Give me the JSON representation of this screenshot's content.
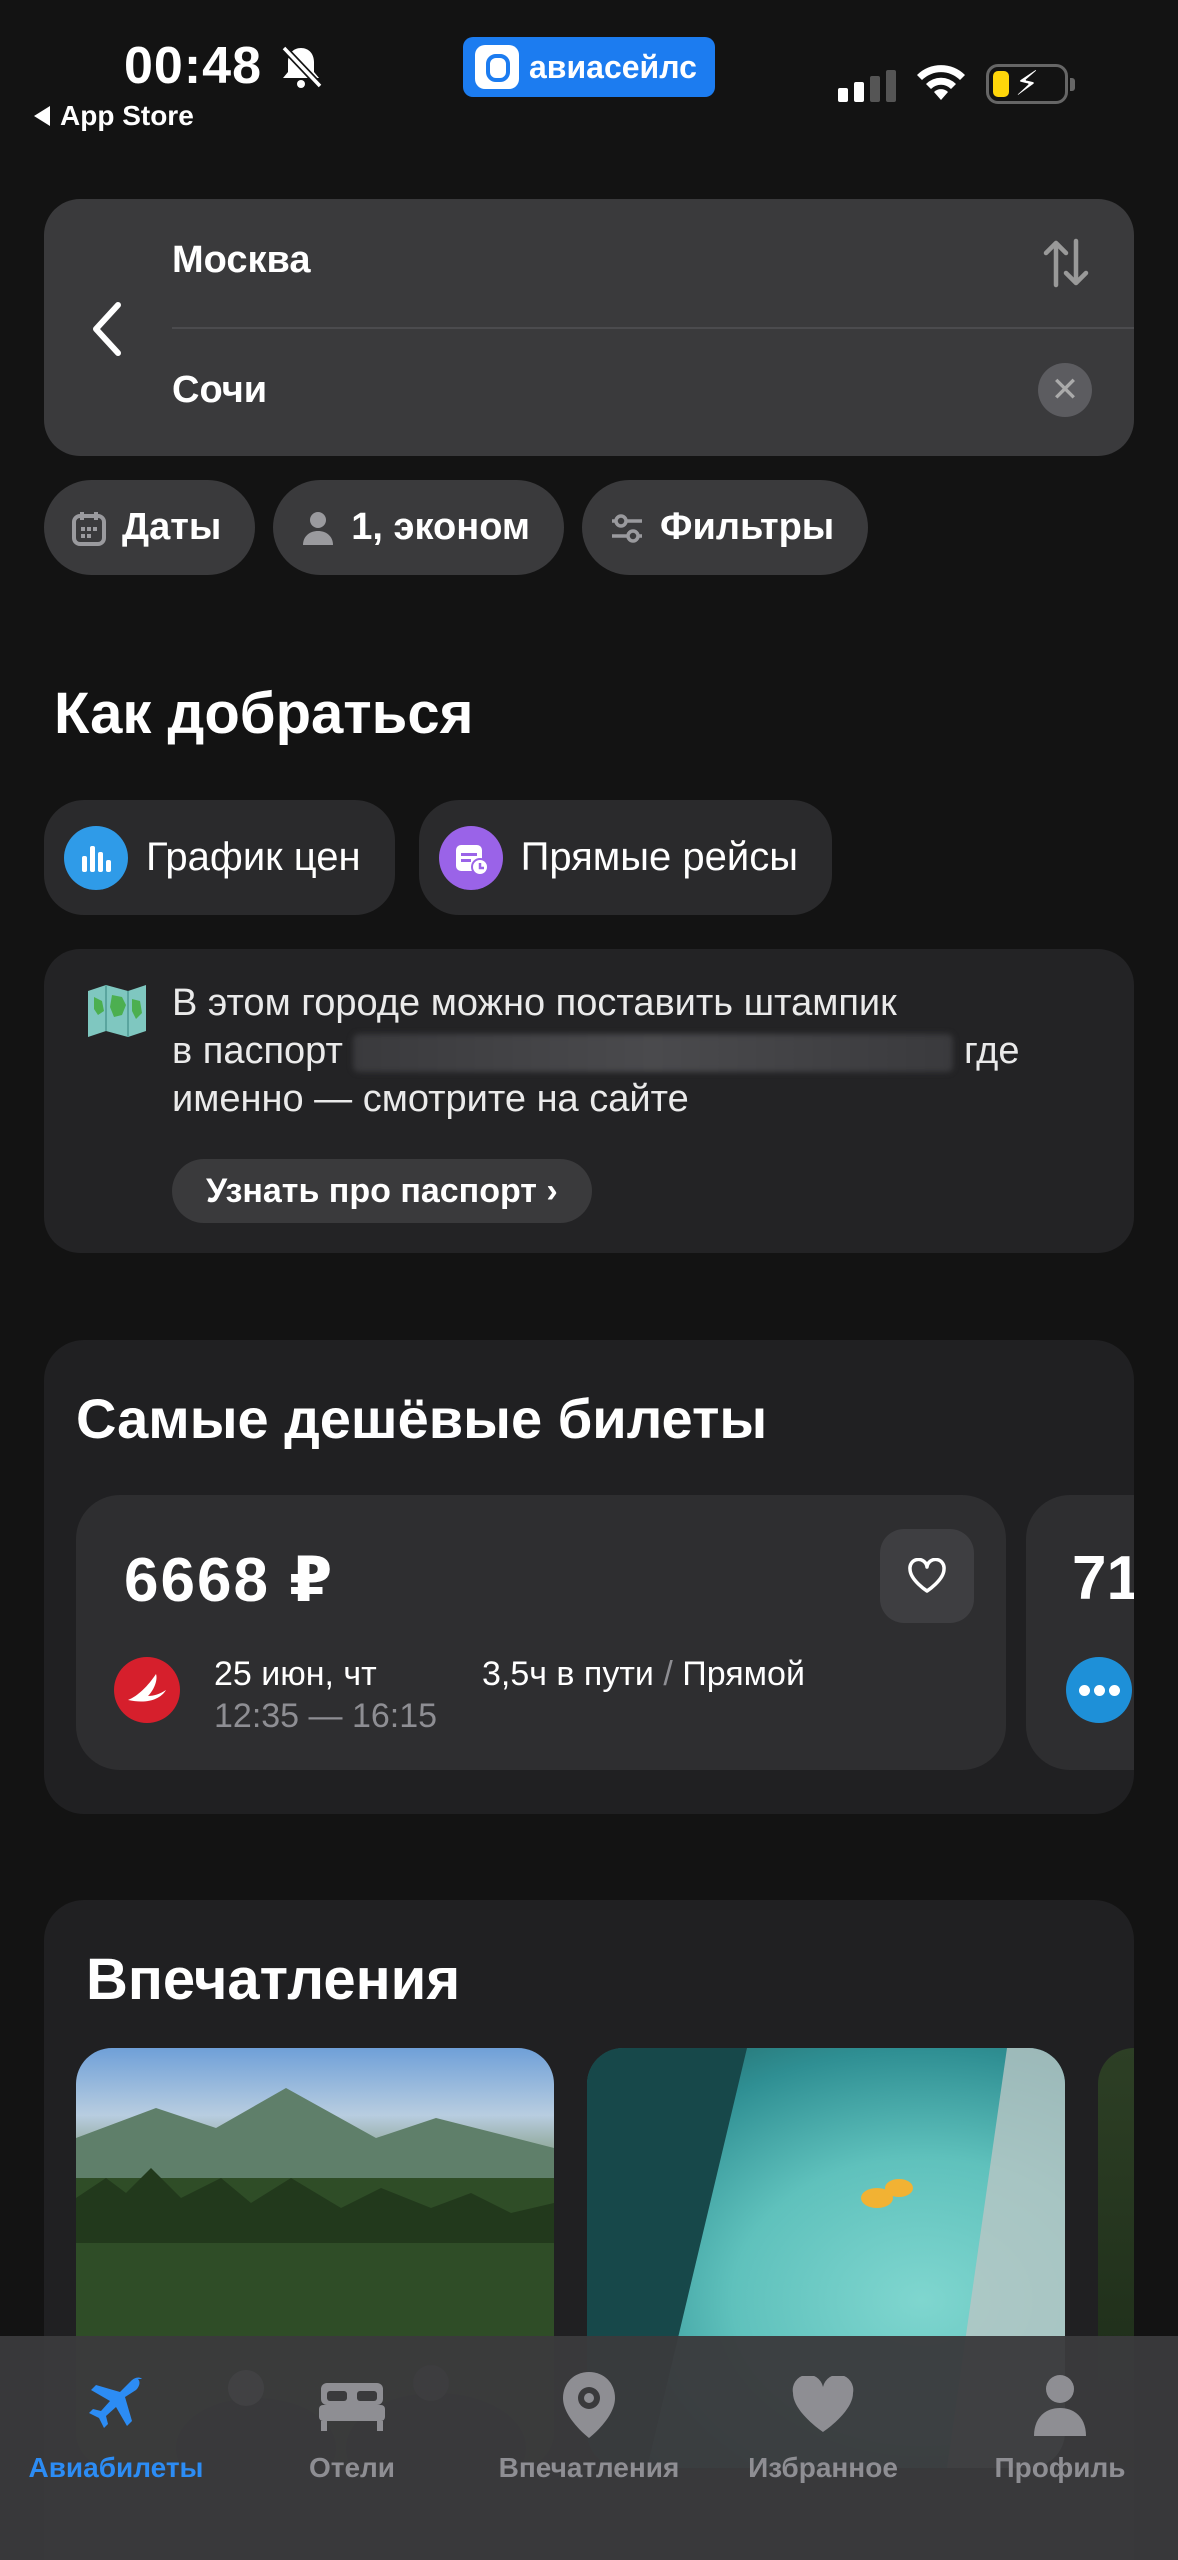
{
  "status_bar": {
    "time": "00:48",
    "back_label": "App Store",
    "brand": "авиасейлс"
  },
  "search": {
    "from": "Москва",
    "to": "Сочи"
  },
  "chips": [
    {
      "label": "Даты",
      "icon": "calendar-icon"
    },
    {
      "label": "1, эконом",
      "icon": "person-icon"
    },
    {
      "label": "Фильтры",
      "icon": "sliders-icon"
    }
  ],
  "how_to_get": {
    "title": "Как добраться",
    "price_chart_label": "График цен",
    "direct_flights_label": "Прямые рейсы"
  },
  "info_card": {
    "line1": "В этом городе можно поставить штампик",
    "line2_start": "в паспорт",
    "line2_end": "где",
    "line3": "именно — смотрите на сайте",
    "button": "Узнать про паспорт ›"
  },
  "cheapest": {
    "title": "Самые дешёвые билеты",
    "ticket": {
      "price": "6668 ₽",
      "date": "25 июн, чт",
      "times": "12:35 — 16:15",
      "duration": "3,5ч в пути",
      "separator": "/",
      "type": "Прямой"
    },
    "ticket2_price": "71"
  },
  "experiences": {
    "title": "Впечатления"
  },
  "tabbar": [
    {
      "label": "Авиабилеты",
      "icon": "airplane-icon",
      "active": true
    },
    {
      "label": "Отели",
      "icon": "bed-icon"
    },
    {
      "label": "Впечатления",
      "icon": "location-pin-icon"
    },
    {
      "label": "Избранное",
      "icon": "heart-icon"
    },
    {
      "label": "Профиль",
      "icon": "profile-icon"
    }
  ],
  "colors": {
    "accent": "#2c8cf4",
    "brand_blue": "#1c7cf0",
    "airline_red": "#d61f2c"
  }
}
